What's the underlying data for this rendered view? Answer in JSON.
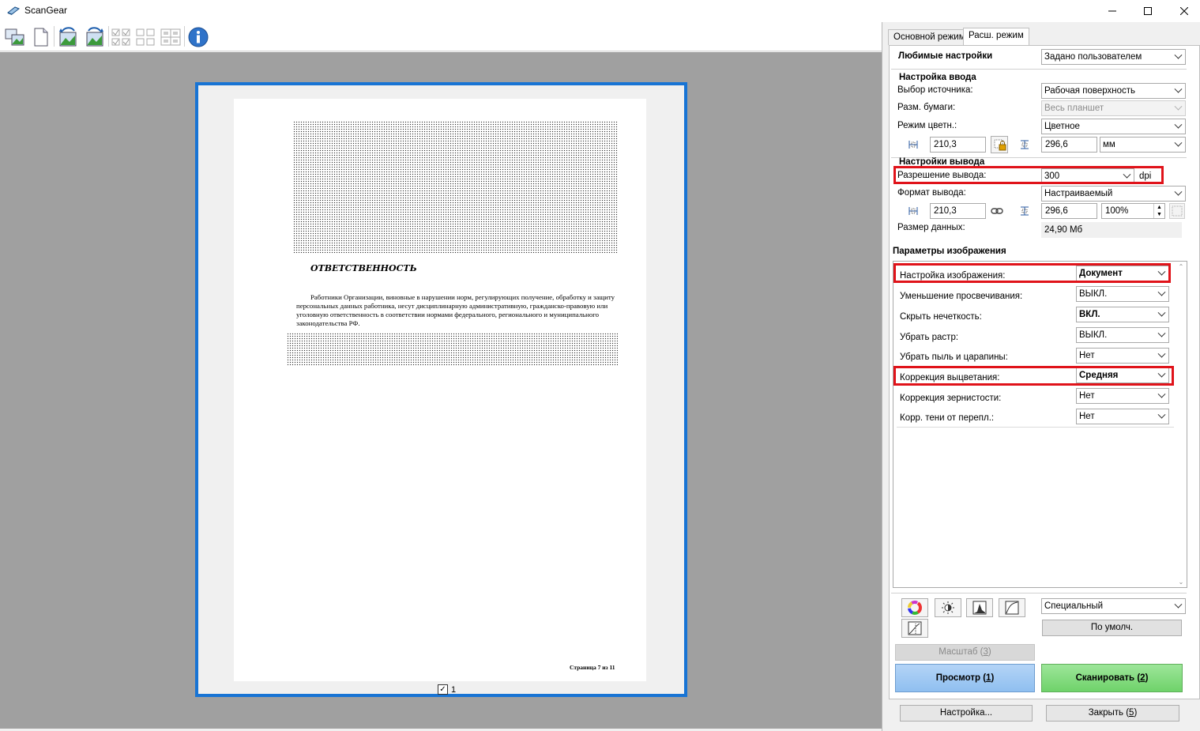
{
  "window": {
    "title": "ScanGear"
  },
  "toolbar": {
    "buttons": [
      "thumbnail-view",
      "whole-image-view",
      "rotate-left",
      "rotate-right",
      "select-all-frames",
      "deselect-frames",
      "frame-grid",
      "frame-grid-2",
      "info"
    ]
  },
  "preview": {
    "document": {
      "heading": "ОТВЕТСТВЕННОСТЬ",
      "paragraph": "Работники Организации, виновные в нарушении норм, регулирующих получение, обработку и защиту персональных данных работника, несут дисциплинарную административную, гражданско-правовую или уголовную ответственность в соответствии нормами федерального, регионального и муниципального законодательства РФ.",
      "footer": "Страница 7 из 11"
    },
    "frame_label": "1",
    "frame_checked": true
  },
  "tabs": [
    "Основной режим",
    "Расш. режим"
  ],
  "active_tab": "Расш. режим",
  "favorites": {
    "label": "Любимые настройки",
    "value": "Задано пользователем"
  },
  "input_settings": {
    "title": "Настройка ввода",
    "source_label": "Выбор источника:",
    "source_value": "Рабочая поверхность",
    "paper_label": "Разм. бумаги:",
    "paper_value": "Весь планшет",
    "color_label": "Режим цветн.:",
    "color_value": "Цветное",
    "width": "210,3",
    "height": "296,6",
    "unit": "мм"
  },
  "output_settings": {
    "title": "Настройки вывода",
    "resolution_label": "Разрешение вывода:",
    "resolution_value": "300",
    "resolution_unit": "dpi",
    "format_label": "Формат вывода:",
    "format_value": "Настраиваемый",
    "width": "210,3",
    "height": "296,6",
    "scale": "100%",
    "size_label": "Размер данных:",
    "size_value": "24,90 Мб"
  },
  "image_settings": {
    "title": "Параметры изображения",
    "rows": [
      {
        "label": "Настройка изображения:",
        "value": "Документ",
        "bold": true
      },
      {
        "label": "Уменьшение просвечивания:",
        "value": "ВЫКЛ.",
        "bold": false
      },
      {
        "label": "Скрыть нечеткость:",
        "value": "ВКЛ.",
        "bold": true
      },
      {
        "label": "Убрать растр:",
        "value": "ВЫКЛ.",
        "bold": false
      },
      {
        "label": "Убрать пыль и царапины:",
        "value": "Нет",
        "bold": false
      },
      {
        "label": "Коррекция выцветания:",
        "value": "Средняя",
        "bold": true
      },
      {
        "label": "Коррекция зернистости:",
        "value": "Нет",
        "bold": false
      },
      {
        "label": "Корр. тени от перепл.:",
        "value": "Нет",
        "bold": false
      }
    ]
  },
  "adjust": {
    "preset_value": "Специальный",
    "defaults_label": "По умолч."
  },
  "buttons": {
    "zoom_label": "Масштаб",
    "zoom_key": "3",
    "preview_label": "Просмотр",
    "preview_key": "1",
    "scan_label": "Сканировать",
    "scan_key": "2",
    "settings_label": "Настройка...",
    "close_label": "Закрыть",
    "close_key": "5"
  },
  "colors": {
    "accent": "#1874d4",
    "highlight": "#e0131a",
    "preview_btn": "#8fbff0",
    "scan_btn": "#6fd26a"
  }
}
